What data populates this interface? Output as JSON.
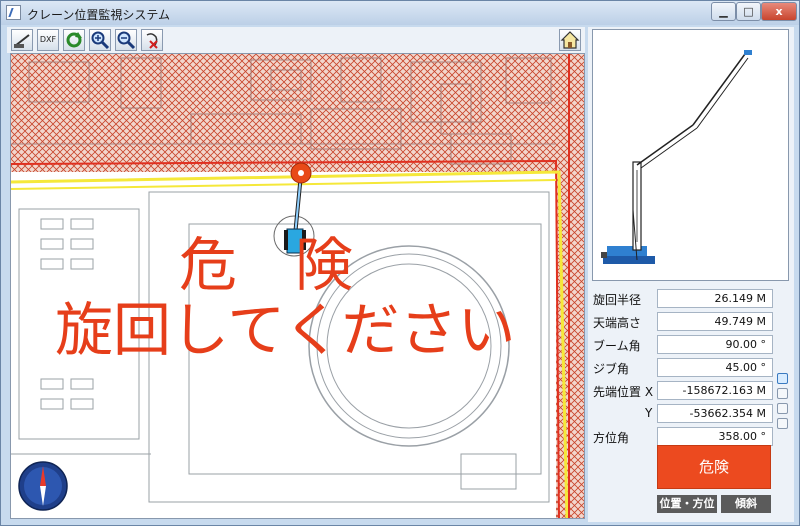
{
  "window": {
    "title": "クレーン位置監視システム",
    "close_label": "x"
  },
  "toolbar": {
    "dxf_label": "DXF"
  },
  "map": {
    "warning_line1": "危　険",
    "warning_line2": "旋回してください"
  },
  "panel": {
    "rows": [
      {
        "label": "旋回半径",
        "value": "26.149  M"
      },
      {
        "label": "天端高さ",
        "value": "49.749  M"
      },
      {
        "label": "ブーム角",
        "value": "90.00 °"
      },
      {
        "label": "ジブ角",
        "value": "45.00 °"
      },
      {
        "label": "先端位置 X",
        "value": "-158672.163  M"
      },
      {
        "label": "Y",
        "value": "-53662.354  M"
      },
      {
        "label": "方位角",
        "value": "358.00 °"
      }
    ],
    "status_button": "危険",
    "btn_position": "位置・方位",
    "btn_tilt": "傾斜"
  },
  "colors": {
    "hazard": "#c8442a",
    "warning_text": "#e63e1a",
    "danger_button": "#ec4a1f",
    "boundary_yellow": "#f5e83a"
  },
  "icons": [
    "crane-icon",
    "dxf-icon",
    "refresh-icon",
    "zoom-in-icon",
    "zoom-out-icon",
    "clear-icon",
    "home-icon",
    "compass-icon"
  ]
}
